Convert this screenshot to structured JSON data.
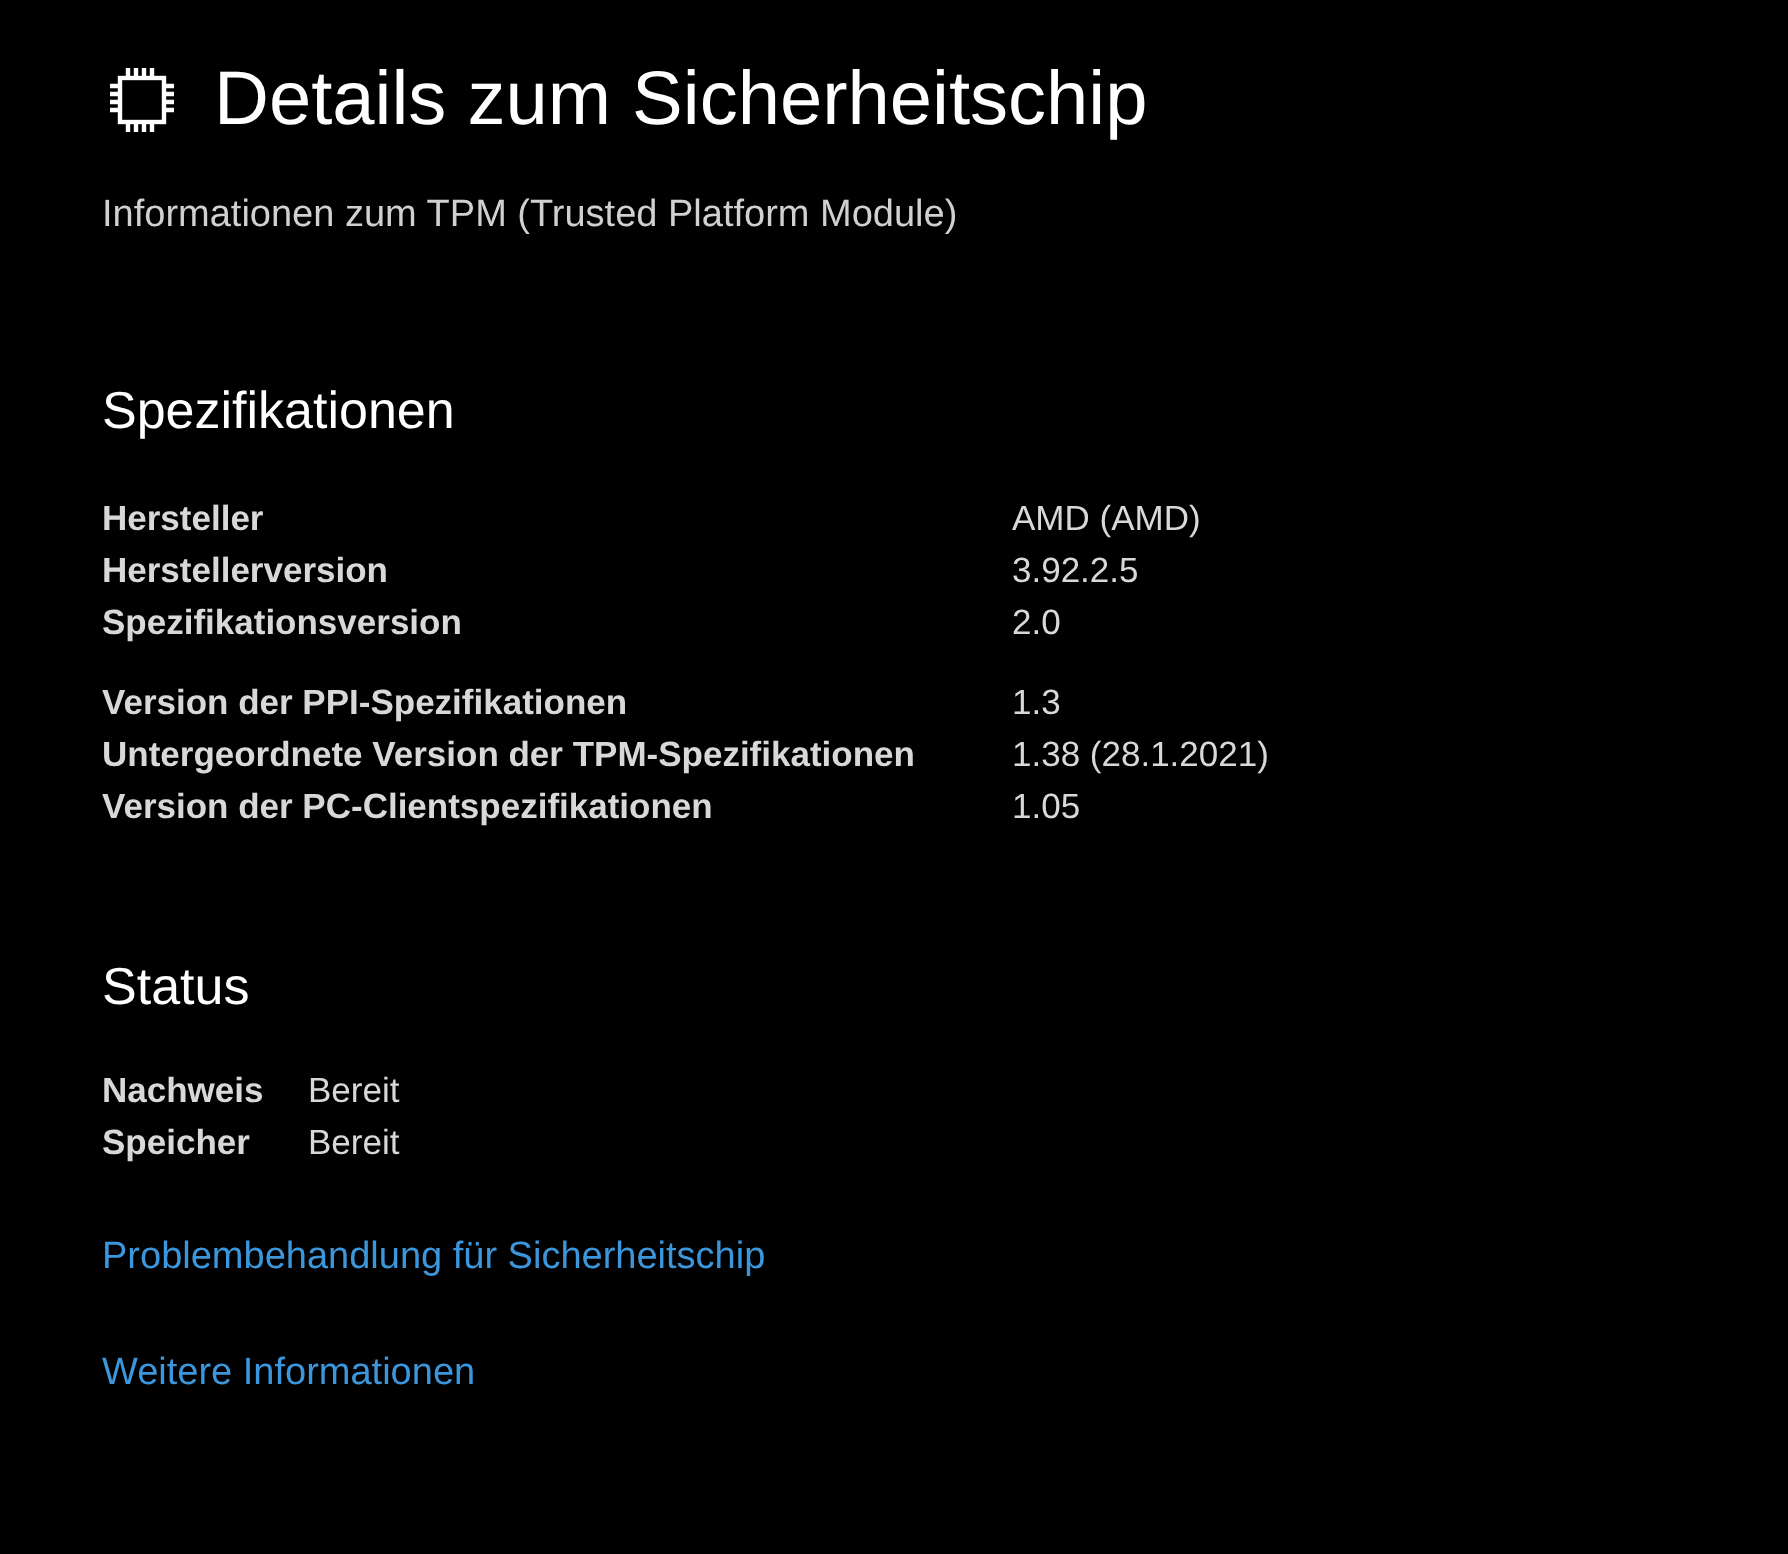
{
  "page": {
    "title": "Details zum Sicherheitschip",
    "subtitle": "Informationen zum TPM (Trusted Platform Module)"
  },
  "specifications": {
    "heading": "Spezifikationen",
    "groups": [
      {
        "rows": [
          {
            "label": "Hersteller",
            "value": "AMD (AMD)"
          },
          {
            "label": "Herstellerversion",
            "value": "3.92.2.5"
          },
          {
            "label": "Spezifikationsversion",
            "value": "2.0"
          }
        ]
      },
      {
        "rows": [
          {
            "label": "Version der PPI-Spezifikationen",
            "value": "1.3"
          },
          {
            "label": "Untergeordnete Version der TPM-Spezifikationen",
            "value": "1.38 (28.1.2021)"
          },
          {
            "label": "Version der PC-Clientspezifikationen",
            "value": "1.05"
          }
        ]
      }
    ]
  },
  "status": {
    "heading": "Status",
    "rows": [
      {
        "label": "Nachweis",
        "value": "Bereit"
      },
      {
        "label": "Speicher",
        "value": "Bereit"
      }
    ]
  },
  "links": [
    "Problembehandlung für Sicherheitschip",
    "Weitere Informationen"
  ]
}
